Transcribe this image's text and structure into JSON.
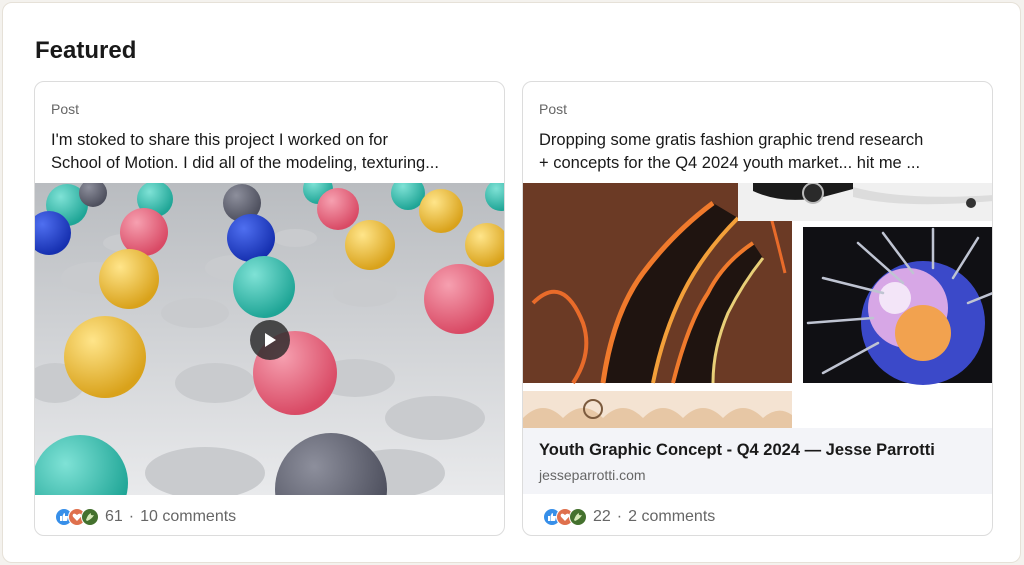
{
  "section": {
    "title": "Featured"
  },
  "cards": [
    {
      "kind": "Post",
      "text_line1": "I'm stoked to share this project I worked on for",
      "text_line2": "School of Motion. I did all of the modeling, texturing...",
      "media_type": "video",
      "reactions": {
        "icons": [
          "like-icon",
          "love-icon",
          "support-icon"
        ],
        "count": "61",
        "comments": "10 comments"
      }
    },
    {
      "kind": "Post",
      "text_line1": "Dropping some gratis fashion graphic trend research",
      "text_line2": "+ concepts for the Q4 2024 youth market... hit me ...",
      "media_type": "image-collage",
      "link": {
        "title": "Youth Graphic Concept - Q4 2024 — Jesse Parrotti",
        "domain": "jesseparrotti.com"
      },
      "reactions": {
        "icons": [
          "like-icon",
          "love-icon",
          "support-icon"
        ],
        "count": "22",
        "comments": "2 comments"
      }
    }
  ],
  "separator": "·",
  "colors": {
    "like": "#378fe9",
    "love": "#df704d",
    "support": "#44712e",
    "muted_text": "#666666"
  }
}
